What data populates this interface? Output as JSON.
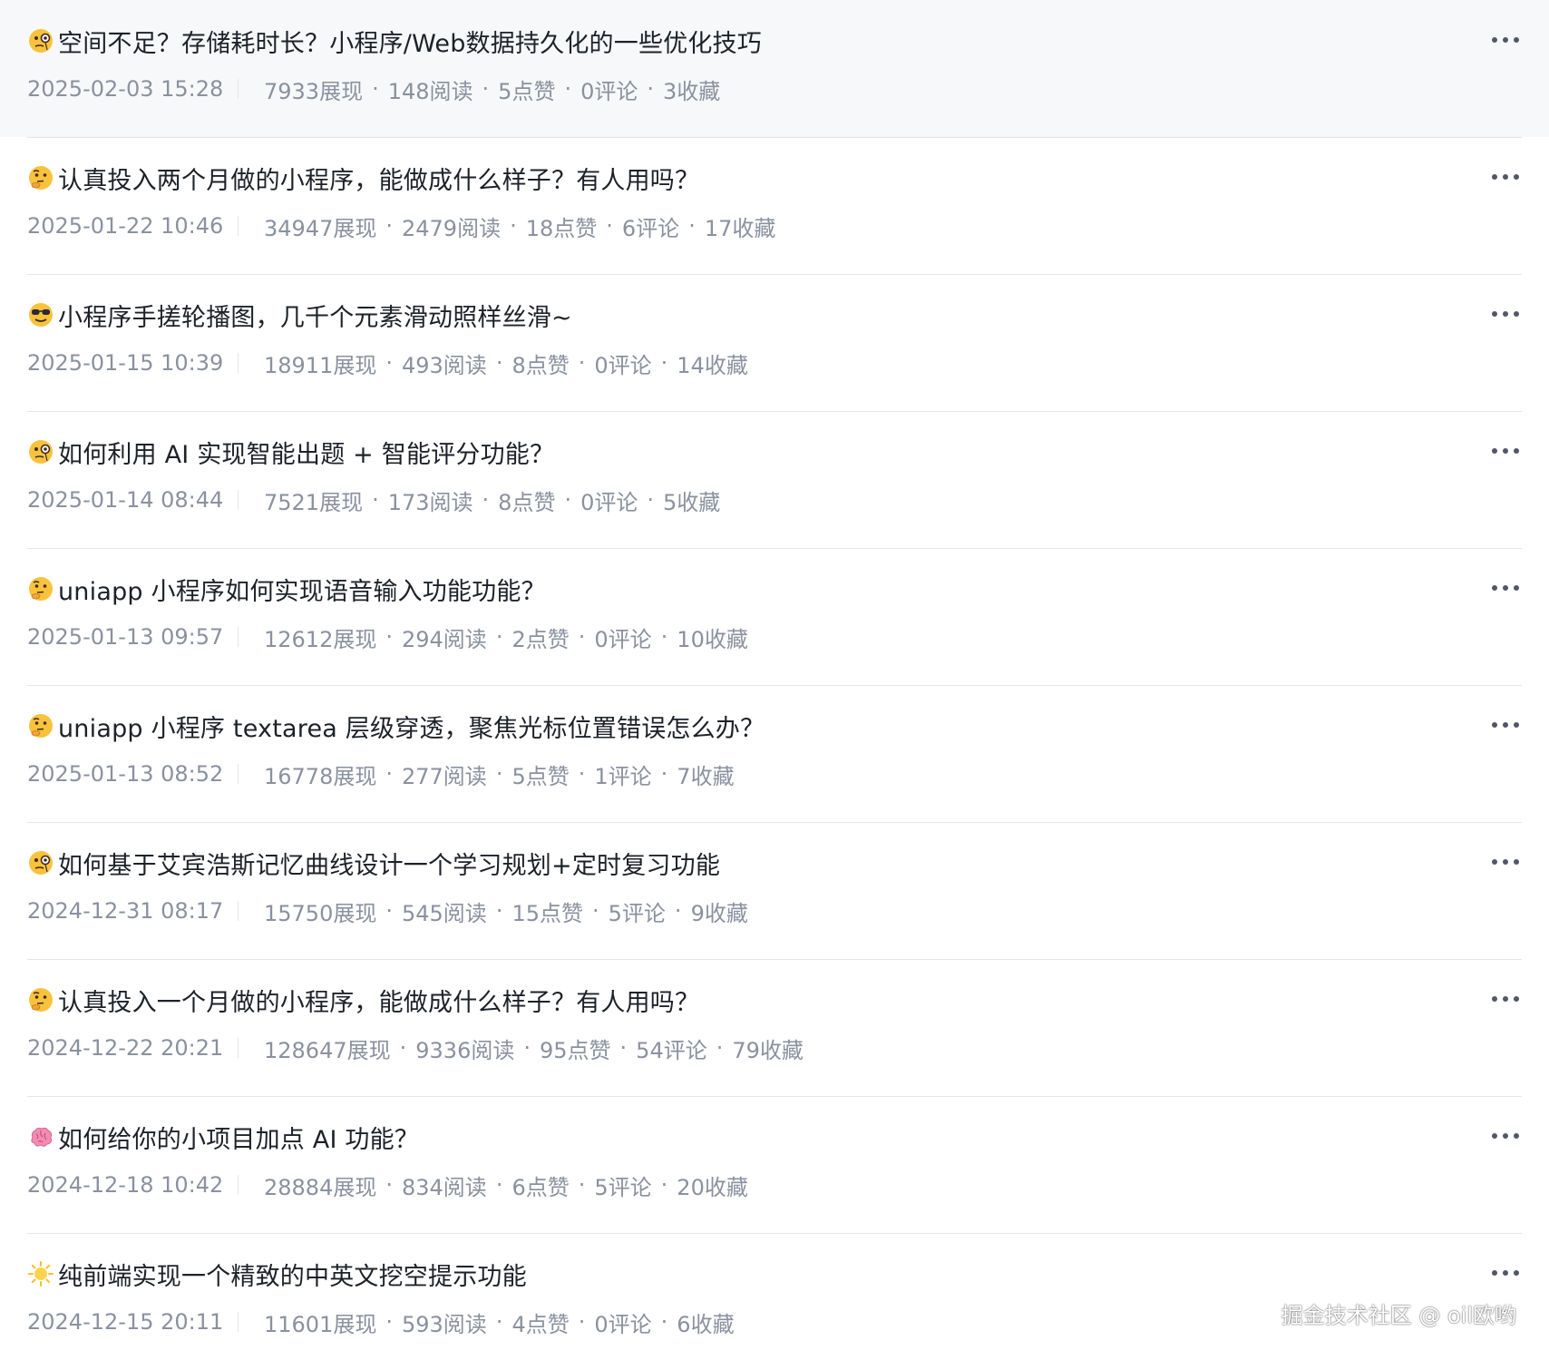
{
  "articles": [
    {
      "emoji": "monocle-face-icon",
      "title": "空间不足？存储耗时长？小程序/Web数据持久化的一些优化技巧",
      "date": "2025-02-03 15:28",
      "views": "7933展现",
      "reads": "148阅读",
      "likes": "5点赞",
      "comments": "0评论",
      "favorites": "3收藏"
    },
    {
      "emoji": "thinking-face-icon",
      "title": "认真投入两个月做的小程序，能做成什么样子？有人用吗？",
      "date": "2025-01-22 10:46",
      "views": "34947展现",
      "reads": "2479阅读",
      "likes": "18点赞",
      "comments": "6评论",
      "favorites": "17收藏"
    },
    {
      "emoji": "sunglasses-face-icon",
      "title": "小程序手搓轮播图，几千个元素滑动照样丝滑~",
      "date": "2025-01-15 10:39",
      "views": "18911展现",
      "reads": "493阅读",
      "likes": "8点赞",
      "comments": "0评论",
      "favorites": "14收藏"
    },
    {
      "emoji": "monocle-face-icon",
      "title": "如何利用 AI 实现智能出题 + 智能评分功能？",
      "date": "2025-01-14 08:44",
      "views": "7521展现",
      "reads": "173阅读",
      "likes": "8点赞",
      "comments": "0评论",
      "favorites": "5收藏"
    },
    {
      "emoji": "thinking-face-icon",
      "title": "uniapp 小程序如何实现语音输入功能功能？",
      "date": "2025-01-13 09:57",
      "views": "12612展现",
      "reads": "294阅读",
      "likes": "2点赞",
      "comments": "0评论",
      "favorites": "10收藏"
    },
    {
      "emoji": "thinking-face-icon",
      "title": "uniapp 小程序 textarea 层级穿透，聚焦光标位置错误怎么办？",
      "date": "2025-01-13 08:52",
      "views": "16778展现",
      "reads": "277阅读",
      "likes": "5点赞",
      "comments": "1评论",
      "favorites": "7收藏"
    },
    {
      "emoji": "monocle-face-icon",
      "title": "如何基于艾宾浩斯记忆曲线设计一个学习规划+定时复习功能",
      "date": "2024-12-31 08:17",
      "views": "15750展现",
      "reads": "545阅读",
      "likes": "15点赞",
      "comments": "5评论",
      "favorites": "9收藏"
    },
    {
      "emoji": "thinking-face-icon",
      "title": "认真投入一个月做的小程序，能做成什么样子？有人用吗？",
      "date": "2024-12-22 20:21",
      "views": "128647展现",
      "reads": "9336阅读",
      "likes": "95点赞",
      "comments": "54评论",
      "favorites": "79收藏"
    },
    {
      "emoji": "brain-icon",
      "title": "如何给你的小项目加点 AI 功能？",
      "date": "2024-12-18 10:42",
      "views": "28884展现",
      "reads": "834阅读",
      "likes": "6点赞",
      "comments": "5评论",
      "favorites": "20收藏"
    },
    {
      "emoji": "sun-icon",
      "title": "纯前端实现一个精致的中英文挖空提示功能",
      "date": "2024-12-15 20:11",
      "views": "11601展现",
      "reads": "593阅读",
      "likes": "4点赞",
      "comments": "0评论",
      "favorites": "6收藏"
    }
  ],
  "stat_separator": "·",
  "watermark": "掘金技术社区 @ oil欧哟",
  "colors": {
    "title": "#1d2129",
    "meta": "#8a919f",
    "divider": "#e5e6eb",
    "hover_bg": "#f7f8fa"
  }
}
